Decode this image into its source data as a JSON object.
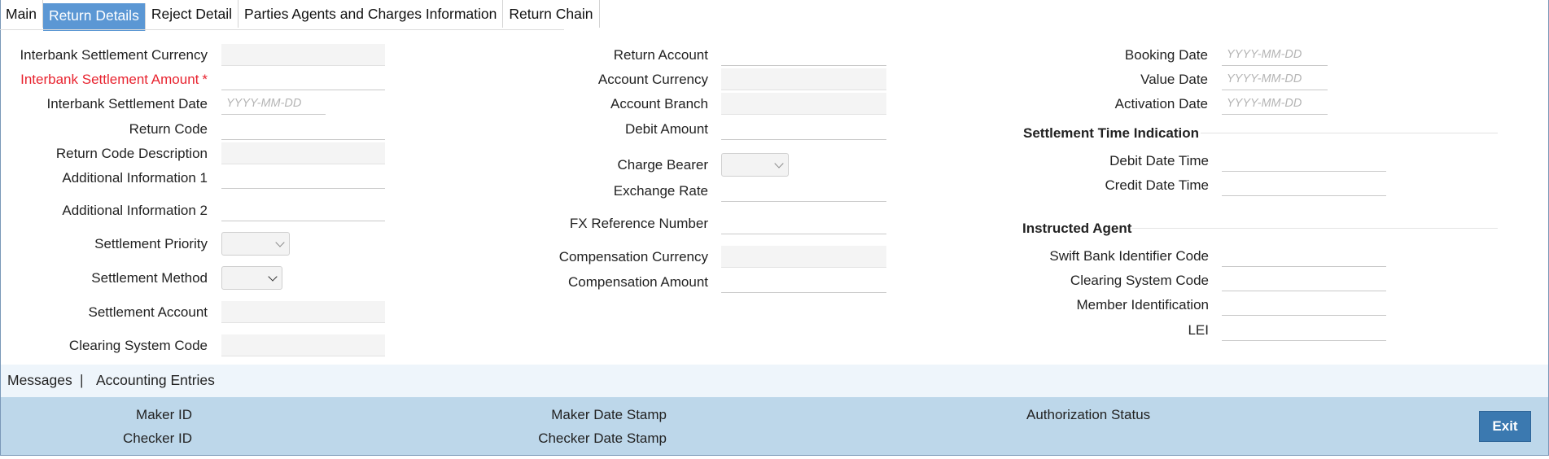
{
  "tabs": [
    "Main",
    "Return Details",
    "Reject Detail",
    "Parties Agents and Charges Information",
    "Return Chain"
  ],
  "left": {
    "interbank_settlement_currency": "Interbank Settlement Currency",
    "interbank_settlement_amount": "Interbank Settlement Amount",
    "required_marker": "*",
    "interbank_settlement_date": "Interbank Settlement Date",
    "return_code": "Return Code",
    "return_code_description": "Return Code Description",
    "additional_information_1": "Additional Information 1",
    "additional_information_2": "Additional Information 2",
    "settlement_priority": "Settlement Priority",
    "settlement_method": "Settlement Method",
    "settlement_account": "Settlement Account",
    "clearing_system_code": "Clearing System Code"
  },
  "middle": {
    "return_account": "Return Account",
    "account_currency": "Account Currency",
    "account_branch": "Account Branch",
    "debit_amount": "Debit Amount",
    "charge_bearer": "Charge Bearer",
    "exchange_rate": "Exchange Rate",
    "fx_reference_number": "FX Reference Number",
    "compensation_currency": "Compensation Currency",
    "compensation_amount": "Compensation Amount"
  },
  "right": {
    "booking_date": "Booking Date",
    "value_date": "Value Date",
    "activation_date": "Activation Date",
    "settlement_time_indication": "Settlement Time Indication",
    "debit_date_time": "Debit Date Time",
    "credit_date_time": "Credit Date Time",
    "instructed_agent": "Instructed Agent",
    "swift_bank_identifier_code": "Swift Bank Identifier Code",
    "clearing_system_code": "Clearing System Code",
    "member_identification": "Member Identification",
    "lei": "LEI"
  },
  "date_placeholder": "YYYY-MM-DD",
  "links": {
    "messages": "Messages",
    "separator": "|",
    "accounting_entries": "Accounting Entries"
  },
  "footer": {
    "maker_id": "Maker ID",
    "checker_id": "Checker ID",
    "maker_date_stamp": "Maker Date Stamp",
    "checker_date_stamp": "Checker Date Stamp",
    "authorization_status": "Authorization Status",
    "exit": "Exit"
  }
}
